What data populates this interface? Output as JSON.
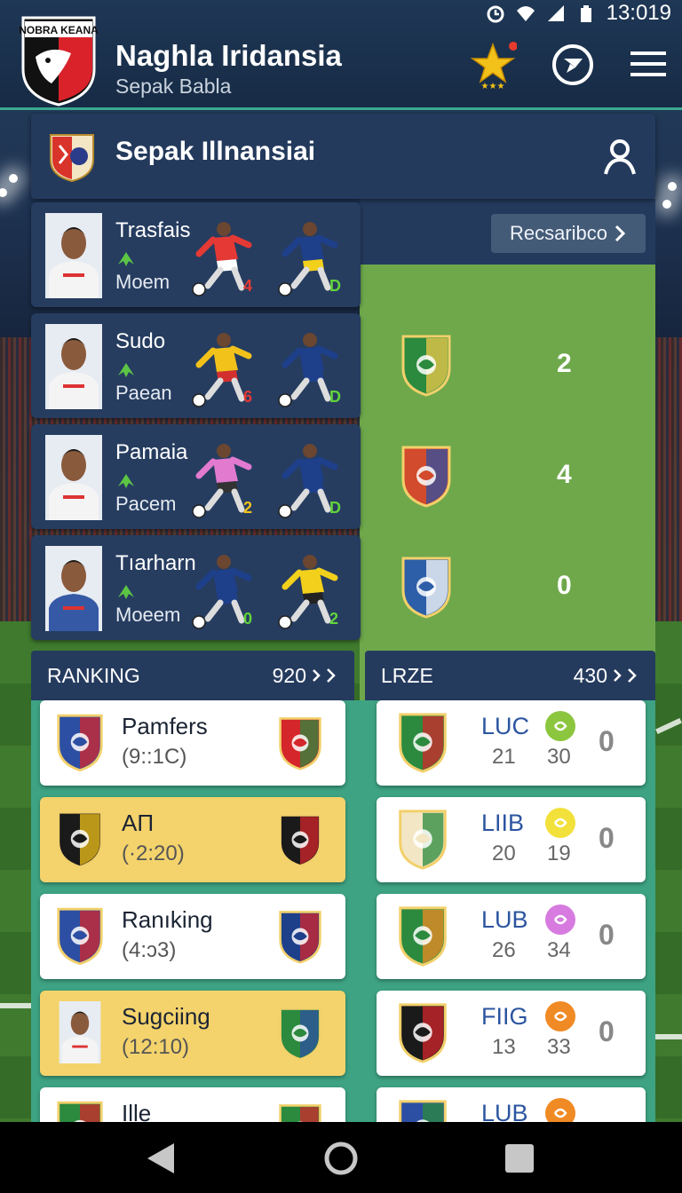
{
  "status_bar": {
    "time": "13:019",
    "icons": [
      "alarm-icon",
      "wifi-icon",
      "signal-icon",
      "battery-icon"
    ]
  },
  "header": {
    "logo_text": "NOBRA KEANA",
    "title": "Naghla Iridansia",
    "subtitle": "Sepak Babla",
    "favorite_icon": "star-icon",
    "action_icon": "chat-icon",
    "menu_icon": "menu-icon"
  },
  "league": {
    "title": "Sepak Illnansiai",
    "user_icon": "user-icon"
  },
  "recs_button": {
    "label": "Recsaribco",
    "icon": "chevron-right-icon"
  },
  "matches": [
    {
      "player": "Trasfais",
      "sub": "Moem",
      "fig1_num": "4",
      "fig2_num": "D",
      "crest_colors": [
        "#2b8a3e",
        "#f2c94c"
      ],
      "score": ""
    },
    {
      "player": "Sudo",
      "sub": "Paean",
      "fig1_num": "6",
      "fig2_num": "D",
      "crest_colors": [
        "#2b8a3e",
        "#f2c94c"
      ],
      "score": "2"
    },
    {
      "player": "Pamaia",
      "sub": "Pacem",
      "fig1_num": "2",
      "fig2_num": "D",
      "crest_colors": [
        "#d14b2c",
        "#2d4fa3"
      ],
      "score": "4"
    },
    {
      "player": "Tıarharn",
      "sub": "Moeem",
      "fig1_num": "0",
      "fig2_num": "2",
      "crest_colors": [
        "#2d5fa8",
        "#ffffff"
      ],
      "score": "0"
    }
  ],
  "ranking": {
    "title": "RANKING",
    "count": "920",
    "items": [
      {
        "name": "Pamfers",
        "sub": "(9::1C)",
        "highlight": false
      },
      {
        "name": "AΠ",
        "sub": "(·2:20)",
        "highlight": true
      },
      {
        "name": "Ranıking",
        "sub": "(4:ɔ3)",
        "highlight": false
      },
      {
        "name": "Sugciing",
        "sub": "(12:10)",
        "highlight": true
      },
      {
        "name": "Ille",
        "sub": "",
        "highlight": false
      }
    ]
  },
  "lrze": {
    "title": "LRZE",
    "count": "430",
    "items": [
      {
        "code": "LUC",
        "a": "21",
        "b": "30",
        "score": "0",
        "dot_color": "#8cc63f"
      },
      {
        "code": "LIIB",
        "a": "20",
        "b": "19",
        "score": "0",
        "dot_color": "#f2e13a"
      },
      {
        "code": "LUB",
        "a": "26",
        "b": "34",
        "score": "0",
        "dot_color": "#d77be0"
      },
      {
        "code": "FIIG",
        "a": "13",
        "b": "33",
        "score": "0",
        "dot_color": "#f08a24"
      },
      {
        "code": "LUB",
        "a": "",
        "b": "",
        "score": "",
        "dot_color": "#f08a24"
      }
    ]
  },
  "nav": {
    "back_icon": "back-icon",
    "home_icon": "home-icon",
    "recents_icon": "recents-icon"
  },
  "colors": {
    "header_bg": "#1e3755",
    "card_bg": "#263d60",
    "green_panel": "#6ea84b",
    "teal_panel": "#3ea383",
    "highlight": "#f4d36c",
    "accent": "#3aa88f"
  }
}
